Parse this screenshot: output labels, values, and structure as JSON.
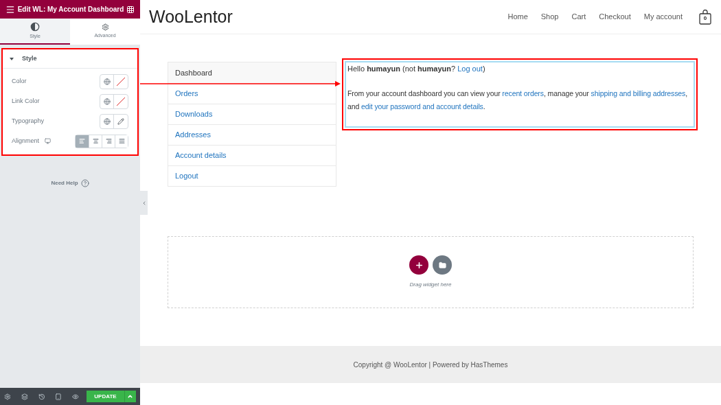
{
  "panel": {
    "title": "Edit WL: My Account Dashboard",
    "tabs": [
      {
        "label": "Style",
        "kind": "style",
        "selected": true
      },
      {
        "label": "Advanced",
        "kind": "advanced",
        "selected": false
      }
    ],
    "section": {
      "title": "Style",
      "expanded": true
    },
    "controls": [
      {
        "label": "Color",
        "kind": "color"
      },
      {
        "label": "Link Color",
        "kind": "color"
      },
      {
        "label": "Typography",
        "kind": "typography"
      },
      {
        "label": "Alignment",
        "kind": "alignment",
        "options": [
          {
            "kind": "left",
            "selected": true
          },
          {
            "kind": "center",
            "selected": false
          },
          {
            "kind": "right",
            "selected": false
          },
          {
            "kind": "justify",
            "selected": false
          }
        ]
      }
    ],
    "help": "Need Help",
    "update_button": "UPDATE"
  },
  "site": {
    "logo": "WooLentor",
    "nav": [
      "Home",
      "Shop",
      "Cart",
      "Checkout",
      "My account"
    ],
    "cart_count": "0"
  },
  "account_nav": [
    {
      "label": "Dashboard",
      "selected": true
    },
    {
      "label": "Orders",
      "selected": false
    },
    {
      "label": "Downloads",
      "selected": false
    },
    {
      "label": "Addresses",
      "selected": false
    },
    {
      "label": "Account details",
      "selected": false
    },
    {
      "label": "Logout",
      "selected": false
    }
  ],
  "greeting": [
    {
      "kind": "text",
      "text": "Hello **humayun** (not **humayun**? "
    },
    {
      "kind": "link",
      "text": "Log out"
    },
    {
      "kind": "text",
      "text": ")"
    }
  ],
  "intro": [
    {
      "kind": "text",
      "text": "From your account dashboard you can view your "
    },
    {
      "kind": "link",
      "text": "recent orders"
    },
    {
      "kind": "text",
      "text": ", manage your "
    },
    {
      "kind": "link",
      "text": "shipping and billing addresses"
    },
    {
      "kind": "text",
      "text": ", and "
    },
    {
      "kind": "link",
      "text": "edit your password and account details"
    },
    {
      "kind": "text",
      "text": "."
    }
  ],
  "drop_zone": {
    "hint": "Drag widget here"
  },
  "footer": "Copyright @ WooLentor | Powered by HasThemes"
}
